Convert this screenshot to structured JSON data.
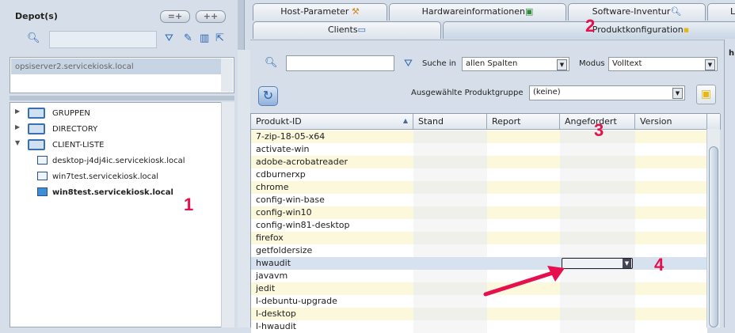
{
  "depots": {
    "title": "Depot(s)",
    "btn_minus": "=+",
    "btn_plus": "++",
    "item": "opsiserver2.servicekiosk.local"
  },
  "tree": {
    "items": [
      {
        "label": "GRUPPEN",
        "arrow": "▶",
        "type": "folder"
      },
      {
        "label": "DIRECTORY",
        "arrow": "▶",
        "type": "folder"
      },
      {
        "label": "CLIENT-LISTE",
        "arrow": "▼",
        "type": "folder"
      },
      {
        "label": "desktop-j4dj4ic.servicekiosk.local",
        "type": "client"
      },
      {
        "label": "win7test.servicekiosk.local",
        "type": "client"
      },
      {
        "label": "win8test.servicekiosk.local",
        "type": "client",
        "selected": true
      }
    ]
  },
  "tabs": {
    "row1": [
      "Host-Parameter",
      "Hardwareinformationen",
      "Software-Inventur",
      "L"
    ],
    "row2": [
      "Clients",
      "Produktkonfiguration"
    ]
  },
  "filter": {
    "suche_in_label": "Suche in",
    "suche_in_value": "allen Spalten",
    "modus_label": "Modus",
    "modus_value": "Volltext",
    "gruppe_label": "Ausgewählte Produktgruppe",
    "gruppe_value": "(keine)"
  },
  "grid": {
    "columns": [
      "Produkt-ID",
      "Stand",
      "Report",
      "Angefordert",
      "Version"
    ],
    "rows": [
      "7-zip-18-05-x64",
      "activate-win",
      "adobe-acrobatreader",
      "cdburnerxp",
      "chrome",
      "config-win-base",
      "config-win10",
      "config-win81-desktop",
      "firefox",
      "getfoldersize",
      "hwaudit",
      "javavm",
      "jedit",
      "l-debuntu-upgrade",
      "l-desktop",
      "l-hwaudit"
    ],
    "selected_row": "hwaudit"
  },
  "annotations": [
    "1",
    "2",
    "3",
    "4"
  ],
  "right_edge": "h"
}
